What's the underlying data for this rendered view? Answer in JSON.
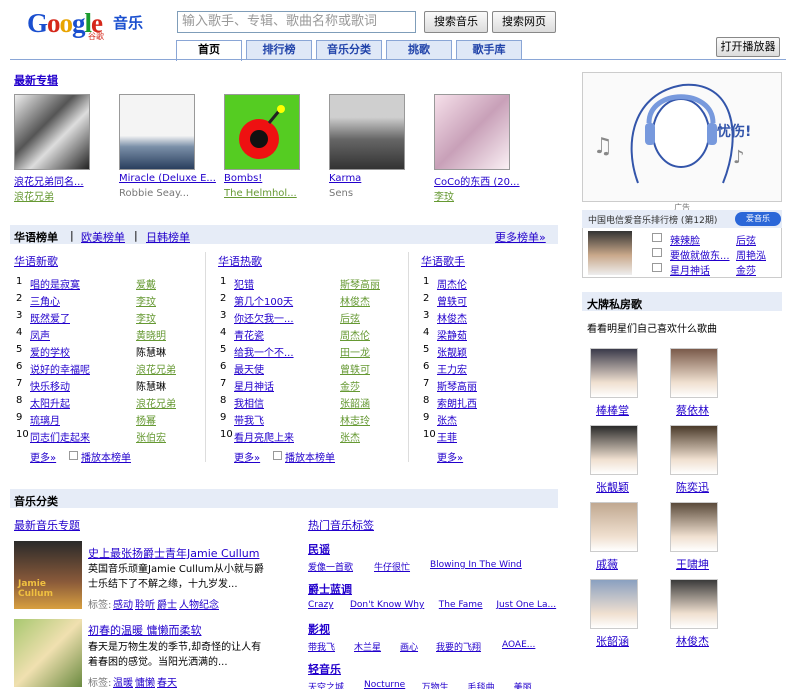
{
  "header": {
    "logo_sub": "谷歌",
    "logo_text": "音乐",
    "search_placeholder": "输入歌手、专辑、歌曲名称或歌词",
    "btn_music": "搜索音乐",
    "btn_web": "搜索网页",
    "btn_player": "打开播放器"
  },
  "tabs": [
    "首页",
    "排行榜",
    "音乐分类",
    "挑歌",
    "歌手库"
  ],
  "albums": {
    "title": "最新专辑",
    "items": [
      {
        "name": "浪花兄弟同名...",
        "artist": "浪花兄弟"
      },
      {
        "name": "Miracle (Deluxe E...",
        "artist": "Robbie Seay..."
      },
      {
        "name": "Bombs!",
        "artist": "The Helmhol..."
      },
      {
        "name": "Karma",
        "artist": "Sens"
      },
      {
        "name": "CoCo的东西 (20...",
        "artist": "李玟"
      }
    ]
  },
  "charts": {
    "tab1": "华语榜单",
    "tab2": "欧美榜单",
    "tab3": "日韩榜单",
    "more": "更多榜单»",
    "cols": [
      {
        "title": "华语新歌",
        "rows": [
          [
            "唱的是寂寞",
            "爱戴"
          ],
          [
            "三角心",
            "李玟"
          ],
          [
            "既然爱了",
            "李玟"
          ],
          [
            "凤声",
            "黄晓明"
          ],
          [
            "爱的学校",
            "陈慧琳"
          ],
          [
            "说好的幸福呢",
            "浪花兄弟"
          ],
          [
            "快乐移动",
            "陈慧琳"
          ],
          [
            "太阳升起",
            "浪花兄弟"
          ],
          [
            "琉璃月",
            "杨幂"
          ],
          [
            "同志们走起来",
            "张伯宏"
          ]
        ]
      },
      {
        "title": "华语热歌",
        "rows": [
          [
            "犯错",
            "斯琴高丽"
          ],
          [
            "第几个100天",
            "林俊杰"
          ],
          [
            "你还欠我一...",
            "后弦"
          ],
          [
            "青花瓷",
            "周杰伦"
          ],
          [
            "给我一个不...",
            "田一龙"
          ],
          [
            "最天使",
            "曾轶可"
          ],
          [
            "星月神话",
            "金莎"
          ],
          [
            "我相信",
            "张韶涵"
          ],
          [
            "带我飞",
            "林志玲"
          ],
          [
            "看月亮爬上来",
            "张杰"
          ]
        ]
      },
      {
        "title": "华语歌手",
        "rows": [
          [
            "周杰伦",
            ""
          ],
          [
            "曾轶可",
            ""
          ],
          [
            "林俊杰",
            ""
          ],
          [
            "梁静茹",
            ""
          ],
          [
            "张靓颖",
            ""
          ],
          [
            "王力宏",
            ""
          ],
          [
            "斯琴高丽",
            ""
          ],
          [
            "索朗扎西",
            ""
          ],
          [
            "张杰",
            ""
          ],
          [
            "王菲",
            ""
          ]
        ]
      }
    ],
    "more_short": "更多»",
    "play": "播放本榜单"
  },
  "ad": {
    "label": "广告",
    "text": "忧伤!"
  },
  "telecom": {
    "title": "中国电信爱音乐排行榜 (第12期)",
    "logo": "爱音乐",
    "songs": [
      [
        "辣辣脸",
        "后弦"
      ],
      [
        "要做就做东...",
        "周艳泓"
      ],
      [
        "星月神话",
        "金莎"
      ]
    ]
  },
  "private": {
    "title": "大牌私房歌",
    "sub": "看看明星们自己喜欢什么歌曲",
    "stars": [
      "棒棒堂",
      "蔡依林",
      "张靓颖",
      "陈奕迅",
      "戚薇",
      "王啸坤",
      "张韶涵",
      "林俊杰"
    ]
  },
  "category": {
    "title": "音乐分类",
    "topic_title": "最新音乐专题",
    "topics": [
      {
        "title": "史上最张扬爵士青年Jamie Cullum",
        "desc": "英国音乐顽童Jamie Cullum从小就与爵士乐结下了不解之缘，十九岁发...",
        "tag_label": "标签:",
        "tags": [
          "感动",
          "聆听",
          "爵士",
          "人物纪念"
        ],
        "img": "Jamie Cullum"
      },
      {
        "title": "初春的温暖 慵懒而柔软",
        "desc": "春天是万物生发的季节,却奇怪的让人有着春困的感觉。当阳光洒满的...",
        "tag_label": "标签:",
        "tags": [
          "温暖",
          "慵懒",
          "春天"
        ]
      }
    ],
    "tag_title": "热门音乐标签",
    "groups": [
      {
        "name": "民谣",
        "items": [
          "爱像一首歌",
          "牛仔很忙",
          "Blowing In The Wind"
        ]
      },
      {
        "name": "爵士蓝调",
        "items": [
          "Crazy",
          "Don't Know Why",
          "The Fame",
          "Just One La..."
        ]
      },
      {
        "name": "影视",
        "items": [
          "带我飞",
          "木兰星",
          "画心",
          "我要的飞翔",
          "AOAE..."
        ]
      },
      {
        "name": "轻音乐",
        "items": [
          "天空之城",
          "Nocturne",
          "万物生",
          "毛毯曲",
          "美丽"
        ]
      }
    ]
  },
  "colors": {
    "link": "#2200cc",
    "green": "#669933",
    "tabbg": "#dfe8f7",
    "bar": "#e6ecf7"
  }
}
